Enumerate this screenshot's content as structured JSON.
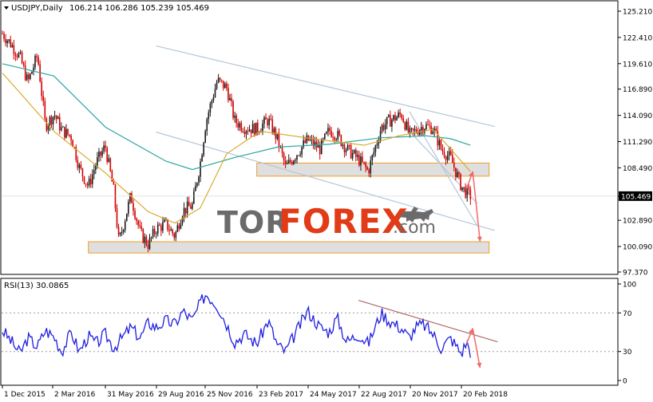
{
  "chart_data": [
    {
      "type": "candlestick",
      "title": "USDJPY,Daily",
      "ohlc_label": "106.214 106.286 105.239 105.469",
      "last_price": 105.469,
      "price_range": [
        97.37,
        125.21
      ],
      "y_ticks": [
        "125.210",
        "122.410",
        "119.610",
        "116.890",
        "114.090",
        "111.290",
        "108.490",
        "105.469",
        "102.890",
        "100.090",
        "97.370"
      ],
      "x_ticks": [
        "1 Dec 2015",
        "2 Mar 2016",
        "31 May 2016",
        "29 Aug 2016",
        "25 Nov 2016",
        "23 Feb 2017",
        "24 May 2017",
        "22 Aug 2017",
        "20 Nov 2017",
        "20 Feb 2018"
      ],
      "price_path": [
        [
          "1 Dec 2015",
          122.8
        ],
        [
          "15 Dec 2015",
          121.8
        ],
        [
          "1 Jan 2016",
          120.3
        ],
        [
          "15 Jan 2016",
          117.6
        ],
        [
          "1 Feb 2016",
          120.5
        ],
        [
          "15 Feb 2016",
          113.0
        ],
        [
          "2 Mar 2016",
          114.2
        ],
        [
          "15 Mar 2016",
          112.5
        ],
        [
          "1 Apr 2016",
          111.8
        ],
        [
          "15 Apr 2016",
          108.5
        ],
        [
          "1 May 2016",
          106.5
        ],
        [
          "15 May 2016",
          109.0
        ],
        [
          "31 May 2016",
          110.8
        ],
        [
          "15 Jun 2016",
          106.0
        ],
        [
          "24 Jun 2016",
          100.5
        ],
        [
          "15 Jul 2016",
          105.5
        ],
        [
          "1 Aug 2016",
          101.5
        ],
        [
          "15 Aug 2016",
          100.3
        ],
        [
          "29 Aug 2016",
          102.0
        ],
        [
          "15 Sep 2016",
          102.5
        ],
        [
          "1 Oct 2016",
          101.2
        ],
        [
          "15 Oct 2016",
          103.9
        ],
        [
          "1 Nov 2016",
          104.5
        ],
        [
          "15 Nov 2016",
          109.0
        ],
        [
          "25 Nov 2016",
          113.4
        ],
        [
          "15 Dec 2016",
          117.8
        ],
        [
          "1 Jan 2017",
          117.0
        ],
        [
          "15 Jan 2017",
          113.5
        ],
        [
          "1 Feb 2017",
          112.8
        ],
        [
          "23 Feb 2017",
          112.6
        ],
        [
          "15 Mar 2017",
          113.6
        ],
        [
          "1 Apr 2017",
          111.5
        ],
        [
          "15 Apr 2017",
          108.5
        ],
        [
          "24 May 2017",
          111.5
        ],
        [
          "15 Jun 2017",
          110.5
        ],
        [
          "1 Jul 2017",
          112.5
        ],
        [
          "15 Jul 2017",
          112.0
        ],
        [
          "1 Aug 2017",
          110.5
        ],
        [
          "22 Aug 2017",
          109.4
        ],
        [
          "8 Sep 2017",
          108.1
        ],
        [
          "1 Oct 2017",
          112.8
        ],
        [
          "15 Oct 2017",
          113.5
        ],
        [
          "6 Nov 2017",
          114.2
        ],
        [
          "20 Nov 2017",
          112.0
        ],
        [
          "1 Dec 2017",
          112.4
        ],
        [
          "15 Dec 2017",
          113.0
        ],
        [
          "1 Jan 2018",
          112.7
        ],
        [
          "15 Jan 2018",
          110.5
        ],
        [
          "1 Feb 2018",
          109.5
        ],
        [
          "20 Feb 2018",
          106.5
        ],
        [
          "1 Mar 2018",
          105.8
        ],
        [
          "8 Mar 2018",
          105.469
        ]
      ],
      "ema_slow": [
        [
          "1 Dec 2015",
          119.6
        ],
        [
          "1 Mar 2016",
          118.3
        ],
        [
          "1 Jun 2016",
          112.8
        ],
        [
          "15 Sep 2016",
          109.2
        ],
        [
          "1 Nov 2016",
          108.3
        ],
        [
          "15 Jan 2017",
          109.6
        ],
        [
          "1 Apr 2017",
          110.7
        ],
        [
          "1 Jul 2017",
          111.0
        ],
        [
          "1 Oct 2017",
          111.7
        ],
        [
          "20 Dec 2017",
          111.9
        ],
        [
          "1 Feb 2018",
          111.6
        ],
        [
          "8 Mar 2018",
          110.9
        ]
      ],
      "ema_fast": [
        [
          "1 Dec 2015",
          118.6
        ],
        [
          "1 Jan 2016",
          116.5
        ],
        [
          "1 Mar 2016",
          112.4
        ],
        [
          "1 Jun 2016",
          107.9
        ],
        [
          "15 Aug 2016",
          103.8
        ],
        [
          "1 Oct 2016",
          102.6
        ],
        [
          "15 Nov 2016",
          104.2
        ],
        [
          "1 Jan 2017",
          110.0
        ],
        [
          "1 Mar 2017",
          112.4
        ],
        [
          "1 Jun 2017",
          111.6
        ],
        [
          "1 Sep 2017",
          110.9
        ],
        [
          "1 Nov 2017",
          111.9
        ],
        [
          "1 Jan 2018",
          112.6
        ],
        [
          "8 Mar 2018",
          108.1
        ]
      ],
      "support_zones": [
        {
          "from": "23 Feb 2017",
          "to": "10 Apr 2018",
          "low": 107.6,
          "high": 109.0
        },
        {
          "from": "1 May 2016",
          "to": "10 Apr 2018",
          "low": 99.4,
          "high": 100.6
        }
      ],
      "channel_lines": [
        [
          [
            "29 Aug 2016",
            121.5
          ],
          [
            "20 Apr 2018",
            112.9
          ]
        ],
        [
          [
            "29 Aug 2016",
            112.3
          ],
          [
            "20 Apr 2018",
            101.8
          ]
        ],
        [
          [
            "20 Nov 2017",
            114.5
          ],
          [
            "20 Mar 2018",
            102.3
          ]
        ],
        [
          [
            "20 Nov 2017",
            112.4
          ],
          [
            "20 Mar 2018",
            104.7
          ]
        ]
      ],
      "forecast_arrows": [
        [
          [
            "1 Mar 2018",
            106.2
          ],
          [
            "12 Mar 2018",
            108.1
          ]
        ],
        [
          [
            "12 Mar 2018",
            108.1
          ],
          [
            "25 Mar 2018",
            100.6
          ]
        ]
      ]
    },
    {
      "type": "line",
      "title": "RSI(13) 30.0865",
      "y_range": [
        0,
        100
      ],
      "y_ticks": [
        "100",
        "70",
        "30",
        "0"
      ],
      "levels": [
        70,
        30
      ],
      "rsi_path": [
        [
          "1 Dec 2015",
          52
        ],
        [
          "15 Dec 2015",
          42
        ],
        [
          "1 Jan 2016",
          28
        ],
        [
          "15 Jan 2016",
          44
        ],
        [
          "1 Feb 2016",
          35
        ],
        [
          "15 Feb 2016",
          52
        ],
        [
          "2 Mar 2016",
          45
        ],
        [
          "15 Mar 2016",
          30
        ],
        [
          "1 Apr 2016",
          50
        ],
        [
          "15 Apr 2016",
          30
        ],
        [
          "1 May 2016",
          46
        ],
        [
          "15 May 2016",
          38
        ],
        [
          "31 May 2016",
          48
        ],
        [
          "15 Jun 2016",
          34
        ],
        [
          "24 Jun 2016",
          40
        ],
        [
          "15 Jul 2016",
          55
        ],
        [
          "1 Aug 2016",
          44
        ],
        [
          "15 Aug 2016",
          60
        ],
        [
          "29 Aug 2016",
          55
        ],
        [
          "15 Sep 2016",
          62
        ],
        [
          "1 Oct 2016",
          58
        ],
        [
          "15 Oct 2016",
          72
        ],
        [
          "1 Nov 2016",
          62
        ],
        [
          "15 Nov 2016",
          80
        ],
        [
          "25 Nov 2016",
          90
        ],
        [
          "15 Dec 2016",
          78
        ],
        [
          "1 Jan 2017",
          58
        ],
        [
          "15 Jan 2017",
          40
        ],
        [
          "1 Feb 2017",
          48
        ],
        [
          "23 Feb 2017",
          38
        ],
        [
          "15 Mar 2017",
          62
        ],
        [
          "1 Apr 2017",
          36
        ],
        [
          "15 Apr 2017",
          30
        ],
        [
          "24 May 2017",
          72
        ],
        [
          "15 Jun 2017",
          55
        ],
        [
          "1 Jul 2017",
          50
        ],
        [
          "15 Jul 2017",
          65
        ],
        [
          "1 Aug 2017",
          40
        ],
        [
          "22 Aug 2017",
          48
        ],
        [
          "8 Sep 2017",
          38
        ],
        [
          "1 Oct 2017",
          70
        ],
        [
          "15 Oct 2017",
          62
        ],
        [
          "6 Nov 2017",
          54
        ],
        [
          "20 Nov 2017",
          44
        ],
        [
          "1 Dec 2017",
          55
        ],
        [
          "15 Dec 2017",
          58
        ],
        [
          "1 Jan 2018",
          48
        ],
        [
          "15 Jan 2018",
          34
        ],
        [
          "1 Feb 2018",
          44
        ],
        [
          "20 Feb 2018",
          28
        ],
        [
          "1 Mar 2018",
          40
        ],
        [
          "8 Mar 2018",
          30
        ]
      ],
      "trendline": [
        [
          "22 Aug 2017",
          83
        ],
        [
          "25 Apr 2018",
          40
        ]
      ],
      "forecast_arrows": [
        [
          [
            "1 Mar 2018",
            38
          ],
          [
            "12 Mar 2018",
            54
          ]
        ],
        [
          [
            "12 Mar 2018",
            54
          ],
          [
            "25 Mar 2018",
            13
          ]
        ]
      ]
    }
  ],
  "watermark": {
    "left": "TOR",
    "right": "FOREX",
    ".com": ".com",
    "logo": "bull-logo"
  },
  "colors": {
    "bull_candle": "#1a1a1a",
    "bear_candle": "#d40000",
    "ema_slow": "#2aa6a0",
    "ema_fast": "#d9a420",
    "channel": "#b4c6d8",
    "zone_fill": "#d9d9d9",
    "zone_border": "#f0a028",
    "arrow": "#ef6a6a",
    "rsi_line": "#1f1fe0",
    "rsi_trend": "#b06a6a",
    "price_tag": "#000000",
    "watermark_dark": "#6b6b6b",
    "watermark_red": "#e23b17"
  }
}
